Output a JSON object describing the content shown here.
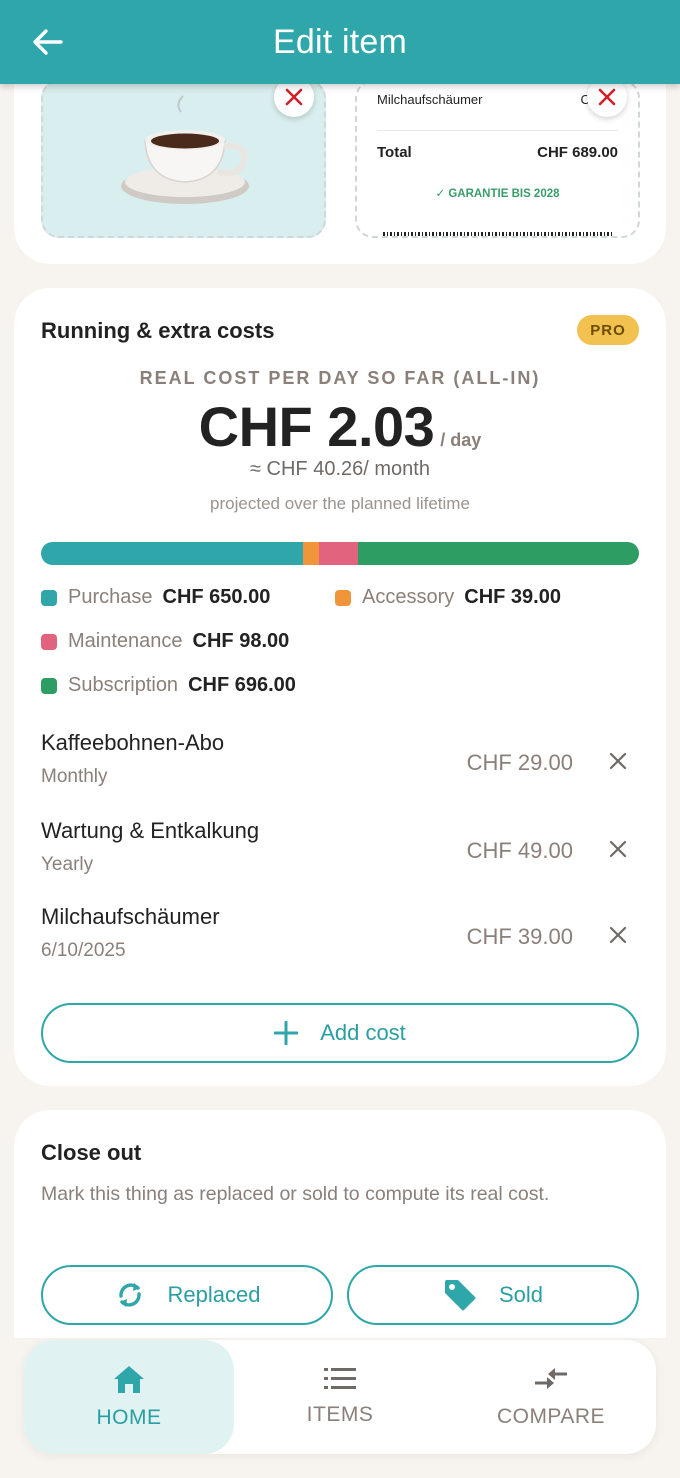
{
  "header": {
    "title": "Edit item"
  },
  "receipt": {
    "item_name": "Milchaufschäumer",
    "item_amount": "CHF 3",
    "total_label": "Total",
    "total_amount": "CHF 689.00",
    "guarantee": "✓ GARANTIE BIS 2028"
  },
  "running_costs": {
    "title": "Running & extra costs",
    "badge": "PRO",
    "kpi_label": "REAL COST PER DAY SO FAR (ALL-IN)",
    "kpi_value": "CHF 2.03",
    "kpi_unit": "/ day",
    "kpi_month": "≈ CHF 40.26/ month",
    "kpi_note": "projected over the planned lifetime",
    "breakdown": [
      {
        "name": "Purchase",
        "amount": "CHF 650.00",
        "value": 650,
        "color": "#2fa6a9"
      },
      {
        "name": "Accessory",
        "amount": "CHF 39.00",
        "value": 39,
        "color": "#f0953a"
      },
      {
        "name": "Maintenance",
        "amount": "CHF 98.00",
        "value": 98,
        "color": "#e2637e"
      },
      {
        "name": "Subscription",
        "amount": "CHF 696.00",
        "value": 696,
        "color": "#2e9d64"
      }
    ],
    "items": [
      {
        "name": "Kaffeebohnen-Abo",
        "sub": "Monthly",
        "amount": "CHF 29.00"
      },
      {
        "name": "Wartung & Entkalkung",
        "sub": "Yearly",
        "amount": "CHF 49.00"
      },
      {
        "name": "Milchaufschäumer",
        "sub": "6/10/2025",
        "amount": "CHF 39.00"
      }
    ],
    "add_label": "Add cost"
  },
  "close_out": {
    "title": "Close out",
    "description": "Mark this thing as replaced or sold to compute its real cost.",
    "replaced_label": "Replaced",
    "sold_label": "Sold"
  },
  "nav": {
    "home": "HOME",
    "items": "ITEMS",
    "compare": "COMPARE"
  },
  "colors": {
    "accent": "#2fa6a9",
    "danger": "#d0202a",
    "pro": "#f1c24f"
  }
}
